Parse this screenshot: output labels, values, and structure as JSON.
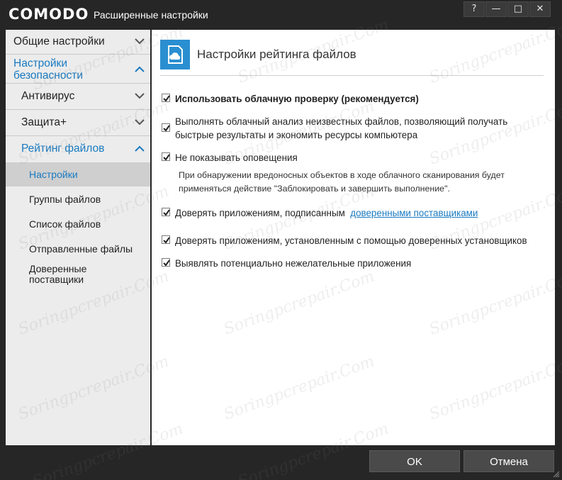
{
  "window": {
    "brand": "COMODO",
    "title": "Расширенные настройки",
    "controls": {
      "help": "?",
      "minimize": "—",
      "maximize": "□",
      "close": "✕"
    }
  },
  "sidebar": {
    "general_settings": "Общие настройки",
    "security_settings": "Настройки безопасности",
    "antivirus": "Антивирус",
    "protection_plus": "Защита+",
    "file_rating": "Рейтинг файлов",
    "sub_items": [
      {
        "label": "Настройки",
        "active": true
      },
      {
        "label": "Группы файлов"
      },
      {
        "label": "Список файлов"
      },
      {
        "label": "Отправленные файлы"
      },
      {
        "label": "Доверенные поставщики"
      }
    ]
  },
  "main": {
    "header_title": "Настройки рейтинга файлов",
    "options": {
      "cloud_lookup": {
        "label": "Использовать облачную проверку (рекомендуется)",
        "checked": true
      },
      "cloud_analysis": {
        "label": "Выполнять облачный анализ неизвестных файлов, позволяющий получать быстрые результаты и экономить ресурсы компьютера",
        "checked": true
      },
      "no_alerts": {
        "label": "Не показывать оповещения",
        "checked": true
      },
      "no_alerts_note": "При обнаружении вредоносных объектов в ходе облачного сканирования будет применяться действие \"Заблокировать и завершить выполнение\".",
      "trust_signed": {
        "label": "Доверять приложениям, подписанным",
        "link": "доверенными поставщиками",
        "checked": true
      },
      "trust_installers": {
        "label": "Доверять приложениям, установленным с помощью доверенных установщиков",
        "checked": true
      },
      "detect_pua": {
        "label": "Выявлять потенциально нежелательные приложения",
        "checked": true
      }
    }
  },
  "footer": {
    "ok": "OK",
    "cancel": "Отмена"
  },
  "watermark": "Soringpcrepair.Com",
  "colors": {
    "accent": "#1a7ac0",
    "header_icon": "#2a8fd1",
    "titlebar": "#262626",
    "sidebar": "#ececec"
  }
}
